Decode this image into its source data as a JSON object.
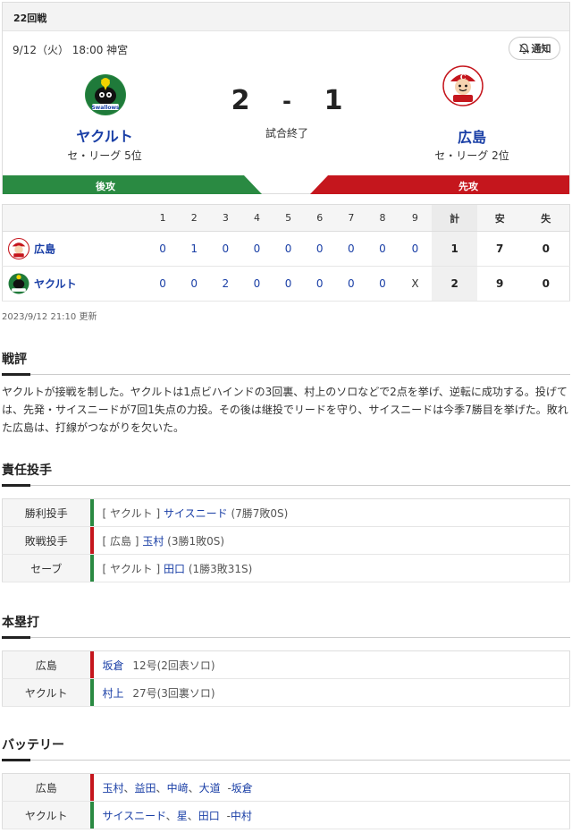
{
  "game": {
    "round": "22回戦",
    "info": "9/12（火） 18:00 神宮",
    "notify_label": "通知",
    "status": "試合終了"
  },
  "home": {
    "name": "ヤクルト",
    "league": "セ・リーグ 5位",
    "score": "2",
    "batting_label": "後攻",
    "color": "#2a8a42"
  },
  "away": {
    "name": "広島",
    "league": "セ・リーグ 2位",
    "score": "1",
    "batting_label": "先攻",
    "color": "#c5161d"
  },
  "score_sep": "-",
  "linescore": {
    "headers": [
      "1",
      "2",
      "3",
      "4",
      "5",
      "6",
      "7",
      "8",
      "9",
      "計",
      "安",
      "失"
    ],
    "rows": [
      {
        "team": "広島",
        "innings": [
          "0",
          "1",
          "0",
          "0",
          "0",
          "0",
          "0",
          "0",
          "0"
        ],
        "r": "1",
        "h": "7",
        "e": "0"
      },
      {
        "team": "ヤクルト",
        "innings": [
          "0",
          "0",
          "2",
          "0",
          "0",
          "0",
          "0",
          "0",
          "X"
        ],
        "r": "2",
        "h": "9",
        "e": "0"
      }
    ],
    "updated": "2023/9/12 21:10 更新"
  },
  "review": {
    "title": "戦評",
    "text": "ヤクルトが接戦を制した。ヤクルトは1点ビハインドの3回裏、村上のソロなどで2点を挙げ、逆転に成功する。投げては、先発・サイスニードが7回1失点の力投。その後は継投でリードを守り、サイスニードは今季7勝目を挙げた。敗れた広島は、打線がつながりを欠いた。"
  },
  "pitchers": {
    "title": "責任投手",
    "rows": [
      {
        "label": "勝利投手",
        "team": "[ ヤクルト ]",
        "name": "サイスニード",
        "record": "(7勝7敗0S)"
      },
      {
        "label": "敗戦投手",
        "team": "[ 広島 ]",
        "name": "玉村",
        "record": "(3勝1敗0S)"
      },
      {
        "label": "セーブ",
        "team": "[ ヤクルト ]",
        "name": "田口",
        "record": "(1勝3敗31S)"
      }
    ]
  },
  "homeruns": {
    "title": "本塁打",
    "rows": [
      {
        "label": "広島",
        "name": "坂倉",
        "detail": "12号(2回表ソロ)"
      },
      {
        "label": "ヤクルト",
        "name": "村上",
        "detail": "27号(3回裏ソロ)"
      }
    ]
  },
  "battery": {
    "title": "バッテリー",
    "rows": [
      {
        "label": "広島",
        "pitchers": [
          "玉村",
          "益田",
          "中﨑",
          "大道"
        ],
        "catcher": "坂倉"
      },
      {
        "label": "ヤクルト",
        "pitchers": [
          "サイスニード",
          "星",
          "田口"
        ],
        "catcher": "中村"
      }
    ],
    "sep": "、",
    "catcher_sep": "-"
  }
}
